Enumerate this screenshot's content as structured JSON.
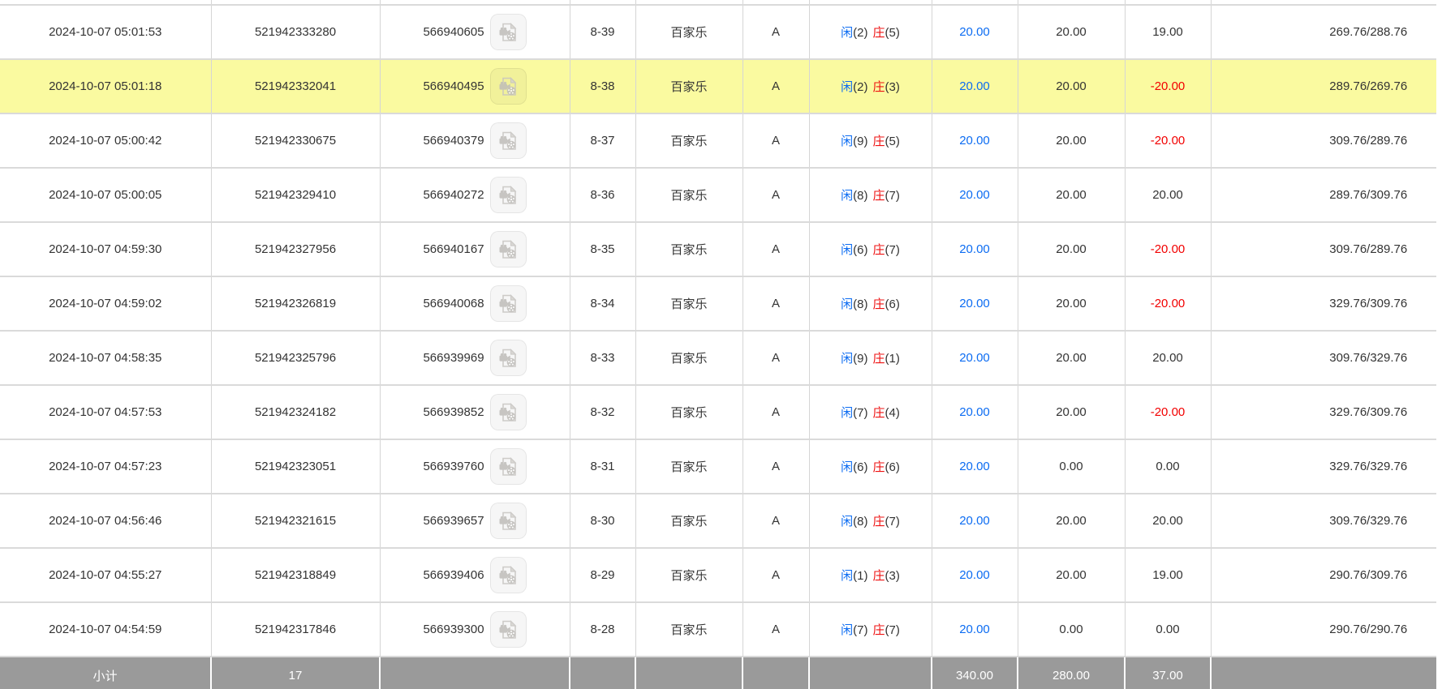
{
  "colors": {
    "accent_blue": "#0c6cf2",
    "zhuang_red": "#ee1111",
    "negative_red": "#f20000",
    "highlight_yellow": "#fafaa0",
    "footer_gray": "#9a9a9a",
    "grid_line": "#d5d5d5"
  },
  "table": {
    "rows": [
      {
        "time": "2024-10-07 05:01:53",
        "bet_id": "521942333280",
        "round_id": "566940605",
        "table_round": "8-39",
        "game": "百家乐",
        "desk": "A",
        "xian_label": "闲",
        "xian_value": "(2)",
        "zhuang_label": "庄",
        "zhuang_value": "(5)",
        "bet_amount": "20.00",
        "valid_amount": "20.00",
        "win_loss": "19.00",
        "balance": "269.76/288.76",
        "highlighted": false
      },
      {
        "time": "2024-10-07 05:01:18",
        "bet_id": "521942332041",
        "round_id": "566940495",
        "table_round": "8-38",
        "game": "百家乐",
        "desk": "A",
        "xian_label": "闲",
        "xian_value": "(2)",
        "zhuang_label": "庄",
        "zhuang_value": "(3)",
        "bet_amount": "20.00",
        "valid_amount": "20.00",
        "win_loss": "-20.00",
        "balance": "289.76/269.76",
        "highlighted": true
      },
      {
        "time": "2024-10-07 05:00:42",
        "bet_id": "521942330675",
        "round_id": "566940379",
        "table_round": "8-37",
        "game": "百家乐",
        "desk": "A",
        "xian_label": "闲",
        "xian_value": "(9)",
        "zhuang_label": "庄",
        "zhuang_value": "(5)",
        "bet_amount": "20.00",
        "valid_amount": "20.00",
        "win_loss": "-20.00",
        "balance": "309.76/289.76",
        "highlighted": false
      },
      {
        "time": "2024-10-07 05:00:05",
        "bet_id": "521942329410",
        "round_id": "566940272",
        "table_round": "8-36",
        "game": "百家乐",
        "desk": "A",
        "xian_label": "闲",
        "xian_value": "(8)",
        "zhuang_label": "庄",
        "zhuang_value": "(7)",
        "bet_amount": "20.00",
        "valid_amount": "20.00",
        "win_loss": "20.00",
        "balance": "289.76/309.76",
        "highlighted": false
      },
      {
        "time": "2024-10-07 04:59:30",
        "bet_id": "521942327956",
        "round_id": "566940167",
        "table_round": "8-35",
        "game": "百家乐",
        "desk": "A",
        "xian_label": "闲",
        "xian_value": "(6)",
        "zhuang_label": "庄",
        "zhuang_value": "(7)",
        "bet_amount": "20.00",
        "valid_amount": "20.00",
        "win_loss": "-20.00",
        "balance": "309.76/289.76",
        "highlighted": false
      },
      {
        "time": "2024-10-07 04:59:02",
        "bet_id": "521942326819",
        "round_id": "566940068",
        "table_round": "8-34",
        "game": "百家乐",
        "desk": "A",
        "xian_label": "闲",
        "xian_value": "(8)",
        "zhuang_label": "庄",
        "zhuang_value": "(6)",
        "bet_amount": "20.00",
        "valid_amount": "20.00",
        "win_loss": "-20.00",
        "balance": "329.76/309.76",
        "highlighted": false
      },
      {
        "time": "2024-10-07 04:58:35",
        "bet_id": "521942325796",
        "round_id": "566939969",
        "table_round": "8-33",
        "game": "百家乐",
        "desk": "A",
        "xian_label": "闲",
        "xian_value": "(9)",
        "zhuang_label": "庄",
        "zhuang_value": "(1)",
        "bet_amount": "20.00",
        "valid_amount": "20.00",
        "win_loss": "20.00",
        "balance": "309.76/329.76",
        "highlighted": false
      },
      {
        "time": "2024-10-07 04:57:53",
        "bet_id": "521942324182",
        "round_id": "566939852",
        "table_round": "8-32",
        "game": "百家乐",
        "desk": "A",
        "xian_label": "闲",
        "xian_value": "(7)",
        "zhuang_label": "庄",
        "zhuang_value": "(4)",
        "bet_amount": "20.00",
        "valid_amount": "20.00",
        "win_loss": "-20.00",
        "balance": "329.76/309.76",
        "highlighted": false
      },
      {
        "time": "2024-10-07 04:57:23",
        "bet_id": "521942323051",
        "round_id": "566939760",
        "table_round": "8-31",
        "game": "百家乐",
        "desk": "A",
        "xian_label": "闲",
        "xian_value": "(6)",
        "zhuang_label": "庄",
        "zhuang_value": "(6)",
        "bet_amount": "20.00",
        "valid_amount": "0.00",
        "win_loss": "0.00",
        "balance": "329.76/329.76",
        "highlighted": false
      },
      {
        "time": "2024-10-07 04:56:46",
        "bet_id": "521942321615",
        "round_id": "566939657",
        "table_round": "8-30",
        "game": "百家乐",
        "desk": "A",
        "xian_label": "闲",
        "xian_value": "(8)",
        "zhuang_label": "庄",
        "zhuang_value": "(7)",
        "bet_amount": "20.00",
        "valid_amount": "20.00",
        "win_loss": "20.00",
        "balance": "309.76/329.76",
        "highlighted": false
      },
      {
        "time": "2024-10-07 04:55:27",
        "bet_id": "521942318849",
        "round_id": "566939406",
        "table_round": "8-29",
        "game": "百家乐",
        "desk": "A",
        "xian_label": "闲",
        "xian_value": "(1)",
        "zhuang_label": "庄",
        "zhuang_value": "(3)",
        "bet_amount": "20.00",
        "valid_amount": "20.00",
        "win_loss": "19.00",
        "balance": "290.76/309.76",
        "highlighted": false
      },
      {
        "time": "2024-10-07 04:54:59",
        "bet_id": "521942317846",
        "round_id": "566939300",
        "table_round": "8-28",
        "game": "百家乐",
        "desk": "A",
        "xian_label": "闲",
        "xian_value": "(7)",
        "zhuang_label": "庄",
        "zhuang_value": "(7)",
        "bet_amount": "20.00",
        "valid_amount": "0.00",
        "win_loss": "0.00",
        "balance": "290.76/290.76",
        "highlighted": false
      }
    ],
    "footer": {
      "label": "小计",
      "count": "17",
      "bet_amount_total": "340.00",
      "valid_amount_total": "280.00",
      "win_loss_total": "37.00"
    }
  }
}
